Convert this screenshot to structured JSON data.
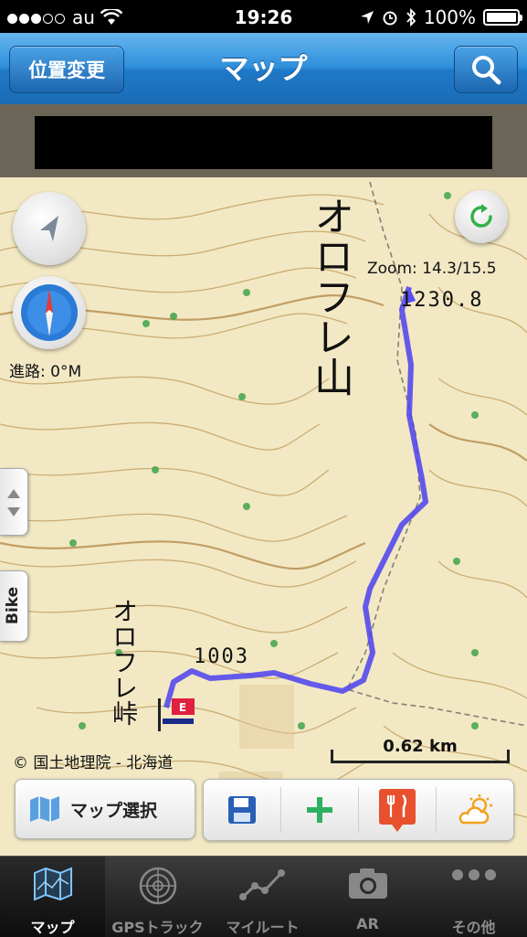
{
  "status_bar": {
    "carrier": "au",
    "time": "19:26",
    "battery": "100%"
  },
  "nav": {
    "title": "マップ",
    "left_button": "位置変更",
    "right_button_icon": "search-icon"
  },
  "map": {
    "zoom": "Zoom: 14.3/15.5",
    "heading": "進路: 0°M",
    "side_tab": "Bike",
    "attribution": "© 国土地理院 - 北海道",
    "scale": "0.62 km",
    "place_labels": {
      "mountain": "オロフレ山",
      "elevation_summit": "1230.8",
      "elevation_point": "1003",
      "pass": "オロフレ峠"
    },
    "track_color": "#4b3ff0"
  },
  "toolbar": {
    "map_select": "マップ選択",
    "tools": [
      "save-icon",
      "add-icon",
      "restaurant-icon",
      "weather-icon"
    ]
  },
  "tabs": [
    {
      "label": "マップ",
      "icon": "map-icon",
      "active": true
    },
    {
      "label": "GPSトラック",
      "icon": "radar-icon",
      "active": false
    },
    {
      "label": "マイルート",
      "icon": "route-icon",
      "active": false
    },
    {
      "label": "AR",
      "icon": "camera-icon",
      "active": false
    },
    {
      "label": "その他",
      "icon": "more-icon",
      "active": false
    }
  ]
}
